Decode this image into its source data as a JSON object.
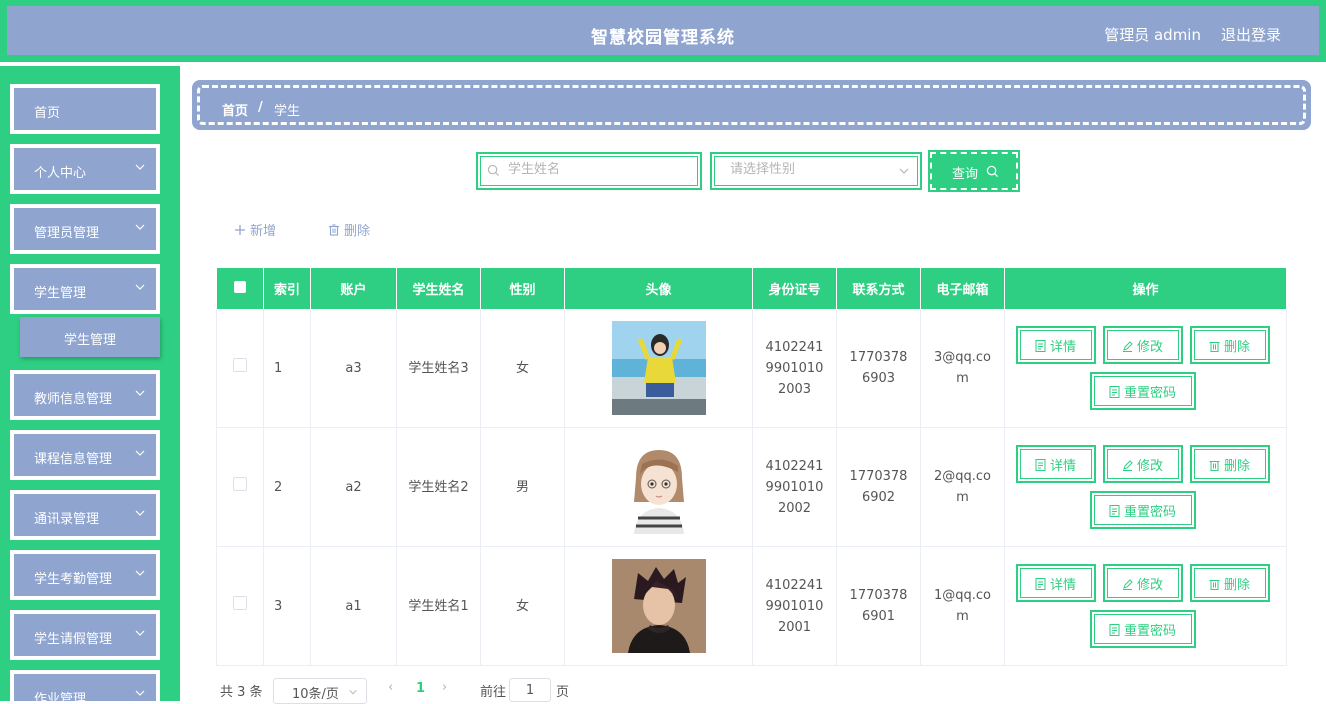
{
  "header": {
    "title": "智慧校园管理系统",
    "user": "管理员 admin",
    "logout": "退出登录"
  },
  "sidebar": {
    "items": [
      {
        "label": "首页",
        "has_arrow": false
      },
      {
        "label": "个人中心",
        "has_arrow": true
      },
      {
        "label": "管理员管理",
        "has_arrow": true
      },
      {
        "label": "学生管理",
        "has_arrow": true
      },
      {
        "label": "教师信息管理",
        "has_arrow": true
      },
      {
        "label": "课程信息管理",
        "has_arrow": true
      },
      {
        "label": "通讯录管理",
        "has_arrow": true
      },
      {
        "label": "学生考勤管理",
        "has_arrow": true
      },
      {
        "label": "学生请假管理",
        "has_arrow": true
      },
      {
        "label": "作业管理",
        "has_arrow": true
      }
    ],
    "submenu_active": "学生管理"
  },
  "breadcrumb": {
    "home": "首页",
    "separator": "/",
    "current": "学生"
  },
  "search": {
    "name_placeholder": "学生姓名",
    "name_value": "",
    "gender_placeholder": "请选择性别",
    "query_label": "查询"
  },
  "toolbar": {
    "add_label": "新增",
    "delete_label": "删除"
  },
  "table": {
    "columns": [
      "索引",
      "账户",
      "学生姓名",
      "性别",
      "头像",
      "身份证号",
      "联系方式",
      "电子邮箱",
      "操作"
    ],
    "rows": [
      {
        "index": "1",
        "account": "a3",
        "name": "学生姓名3",
        "gender": "女",
        "avatar": "avatar-girl-beach",
        "id_number": "410224199010102003",
        "phone": "17703786903",
        "email": "3@qq.com"
      },
      {
        "index": "2",
        "account": "a2",
        "name": "学生姓名2",
        "gender": "男",
        "avatar": "avatar-cartoon-girl",
        "id_number": "410224199010102002",
        "phone": "17703786902",
        "email": "2@qq.com"
      },
      {
        "index": "3",
        "account": "a1",
        "name": "学生姓名1",
        "gender": "女",
        "avatar": "avatar-young-man",
        "id_number": "410224199010102001",
        "phone": "17703786901",
        "email": "1@qq.com"
      }
    ],
    "actions": {
      "detail": "详情",
      "edit": "修改",
      "delete": "删除",
      "reset": "重置密码"
    }
  },
  "pagination": {
    "total_text": "共 3 条",
    "page_size": "10条/页",
    "current_page": "1",
    "goto_label": "前往",
    "goto_value": "1",
    "page_unit": "页"
  },
  "colors": {
    "accent": "#2ecf82",
    "panel": "#8fa4cf",
    "text": "#555555"
  }
}
